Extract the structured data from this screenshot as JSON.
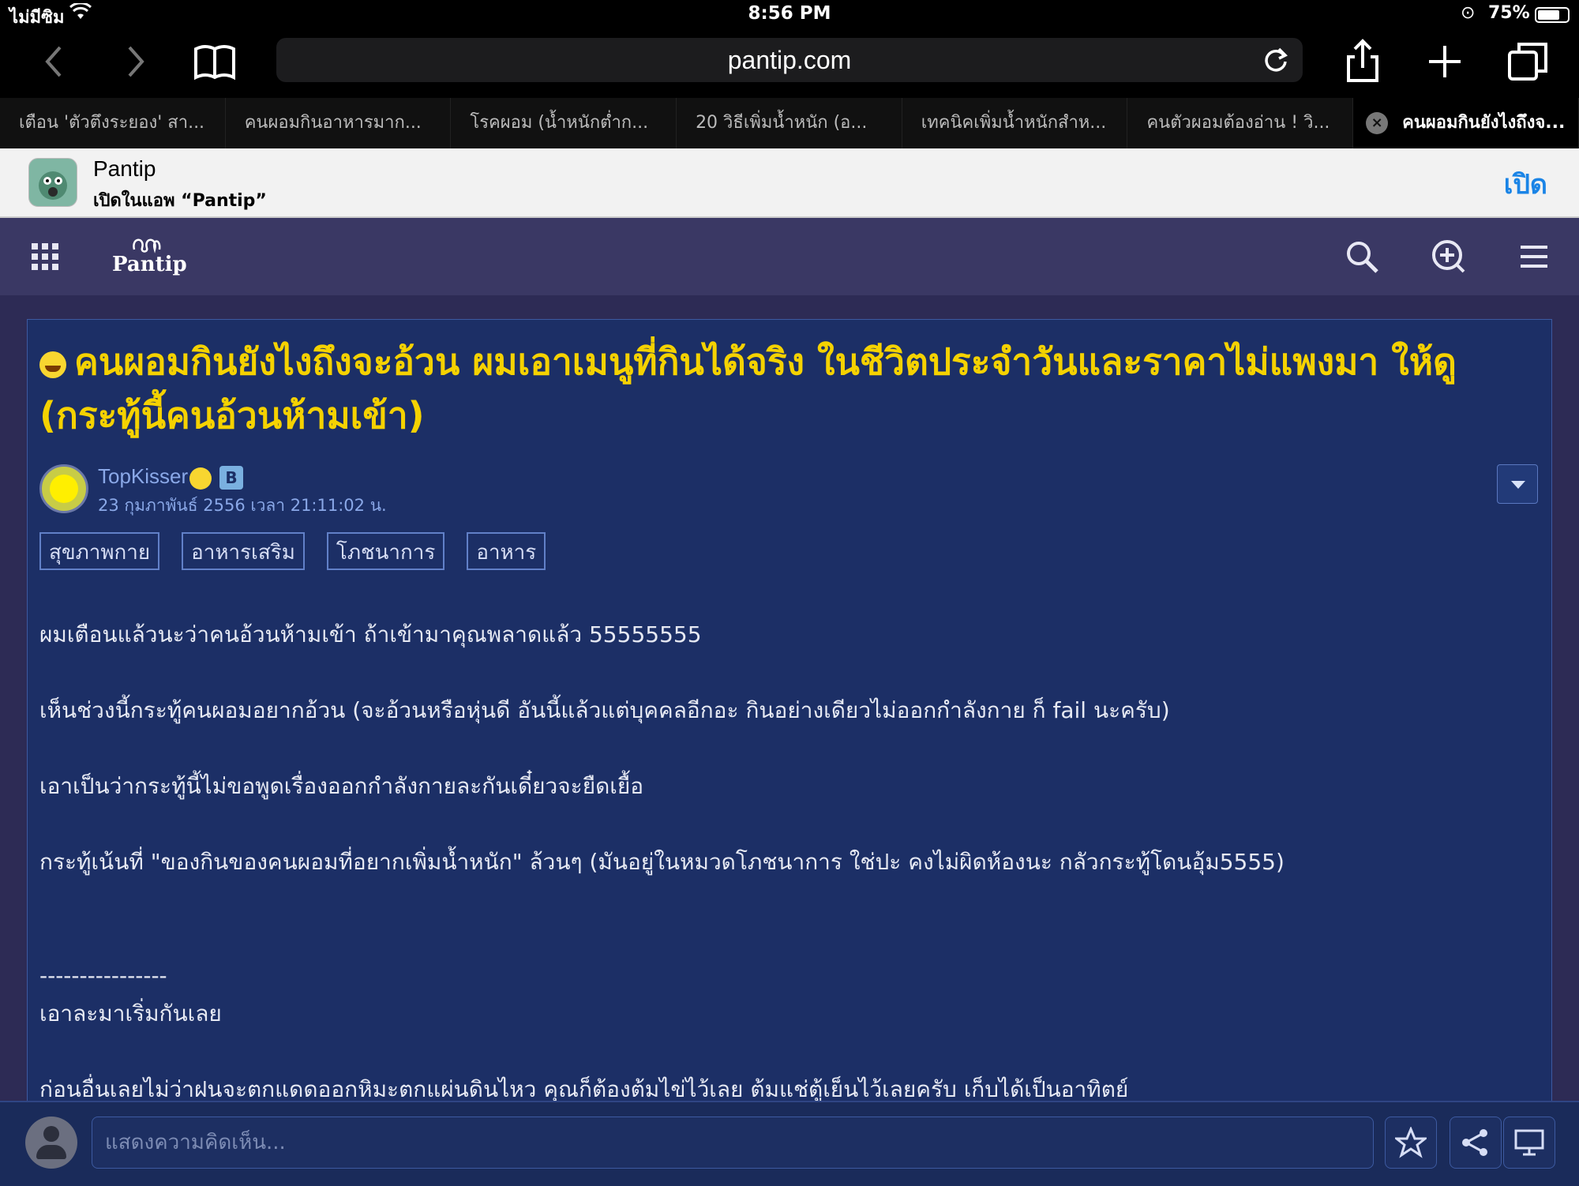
{
  "status_bar": {
    "carrier": "ไม่มีซิม",
    "time": "8:56 PM",
    "battery_text": "75%",
    "battery_level": 0.75
  },
  "browser": {
    "url": "pantip.com",
    "tabs": [
      {
        "label": "เตือน 'ตัวตึงระยอง' สา...",
        "active": false
      },
      {
        "label": "คนผอมกินอาหารมาก...",
        "active": false
      },
      {
        "label": "โรคผอม (น้ำหนักต่ำก...",
        "active": false
      },
      {
        "label": "20 วิธีเพิ่มน้ำหนัก (อ...",
        "active": false
      },
      {
        "label": "เทคนิคเพิ่มน้ำหนักสำห...",
        "active": false
      },
      {
        "label": "คนตัวผอมต้องอ่าน ! วิ...",
        "active": false
      },
      {
        "label": "คนผอมกินยังไงถึงจ...",
        "active": true
      }
    ]
  },
  "app_banner": {
    "name": "Pantip",
    "subtitle": "เปิดในแอพ “Pantip”",
    "open_label": "เปิด"
  },
  "site": {
    "brand": "Pantip"
  },
  "post": {
    "title": "คนผอมกินยังไงถึงจะอ้วน ผมเอาเมนูที่กินได้จริง ในชีวิตประจำวันและราคาไม่แพงมา ให้ดู (กระทู้นี้คนอ้วนห้ามเข้า)",
    "author": "TopKisser",
    "badge": "B",
    "date": "23 กุมภาพันธ์ 2556 เวลา 21:11:02 น.",
    "tags": [
      "สุขภาพกาย",
      "อาหารเสริม",
      "โภชนาการ",
      "อาหาร"
    ],
    "body": [
      "ผมเตือนแล้วนะว่าคนอ้วนห้ามเข้า ถ้าเข้ามาคุณพลาดแล้ว 55555555",
      "",
      "เห็นช่วงนี้กระทู้คนผอมอยากอ้วน (จะอ้วนหรือหุ่นดี อันนี้แล้วแต่บุคคลอีกอะ กินอย่างเดียวไม่ออกกำลังกาย ก็ fail นะครับ)",
      "",
      "เอาเป็นว่ากระทู้นี้ไม่ขอพูดเรื่องออกกำลังกายละกันเดี๋ยวจะยืดเยื้อ",
      "",
      "กระทู้เน้นที่ \"ของกินของคนผอมที่อยากเพิ่มน้ำหนัก\" ล้วนๆ (มันอยู่ในหมวดโภชนาการ ใช่ปะ คงไม่ผิดห้องนะ กลัวกระทู้โดนอุ้ม5555)",
      "",
      "",
      "----------------",
      "เอาละมาเริ่มกันเลย",
      "",
      "ก่อนอื่นเลยไม่ว่าฝนจะตกแดดออกหิมะตกแผ่นดินไหว คุณก็ต้องต้มไข่ไว้เลย ต้มแช่ตู้เย็นไว้เลยครับ เก็บได้เป็นอาทิตย์"
    ]
  },
  "comment_bar": {
    "placeholder": "แสดงความคิดเห็น..."
  },
  "colors": {
    "title": "#f5d200",
    "card_bg": "#1c2f66",
    "header_bg": "#3a3864",
    "page_bg": "#2d2b55",
    "banner_open": "#1a84e6"
  }
}
